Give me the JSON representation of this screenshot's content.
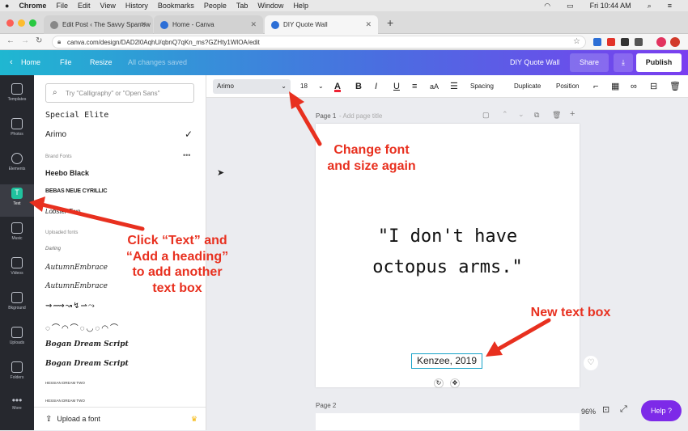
{
  "mac_menu": {
    "apple": "",
    "items": [
      "Chrome",
      "File",
      "Edit",
      "View",
      "History",
      "Bookmarks",
      "People",
      "Tab",
      "Window",
      "Help"
    ],
    "clock": "Fri 10:44 AM"
  },
  "browser": {
    "tabs": [
      {
        "title": "Edit Post ‹ The Savvy Sparrow",
        "color": "#888888"
      },
      {
        "title": "Home - Canva",
        "color": "#2d6fd6"
      },
      {
        "title": "DIY Quote Wall",
        "color": "#2d6fd6"
      }
    ],
    "new_tab": "+",
    "url": "canva.com/design/DAD2l0AqhU/qbnQ7qKn_ms?GZHty1WlOA/edit"
  },
  "canva_header": {
    "home": "Home",
    "file": "File",
    "resize": "Resize",
    "saved": "All changes saved",
    "design_title": "DIY Quote Wall",
    "share": "Share",
    "publish": "Publish"
  },
  "sidebar": {
    "items": [
      {
        "label": "Templates"
      },
      {
        "label": "Photos"
      },
      {
        "label": "Elements"
      },
      {
        "label": "Text"
      },
      {
        "label": "Music"
      },
      {
        "label": "Videos"
      },
      {
        "label": "Bkground"
      },
      {
        "label": "Uploads"
      },
      {
        "label": "Folders"
      },
      {
        "label": "More"
      }
    ]
  },
  "font_panel": {
    "search_placeholder": "Try \"Calligraphy\" or \"Open Sans\"",
    "top_fonts": [
      "Special Elite",
      "Arimo"
    ],
    "brand_heading": "Brand Fonts",
    "brand_fonts": [
      "Heebo Black",
      "BEBAS NEUE CYRILLIC",
      "Lobster Two"
    ],
    "uploaded_heading": "Uploaded fonts",
    "uploaded_fonts": [
      "Darling",
      "AutumnEmbrace",
      "AutumnEmbrace",
      "Arrows",
      "Doodle Arrows",
      "Doodle Circles",
      "Bogan Dream Script",
      "Bogan Dream Script",
      "HESSIAN DREAM TWO",
      "HESSIAN DREAM TWO"
    ],
    "upload_font": "Upload a font"
  },
  "toolbar": {
    "font": "Arimo",
    "size": "18",
    "spacing": "Spacing",
    "duplicate": "Duplicate",
    "position": "Position"
  },
  "page": {
    "label": "Page 1",
    "add_title": "- Add page title",
    "quote_line1": "\"I don't have",
    "quote_line2": "octopus arms.\"",
    "new_text": "Kenzee, 2019",
    "page2_label": "Page 2"
  },
  "bottom": {
    "zoom": "96%",
    "help": "Help ?"
  },
  "annotations": {
    "change_font_1": "Change font",
    "change_font_2": "and size again",
    "click_text_1": "Click “Text” and",
    "click_text_2": "“Add a heading”",
    "click_text_3": "to add another",
    "click_text_4": "text box",
    "new_text_box": "New text box"
  }
}
